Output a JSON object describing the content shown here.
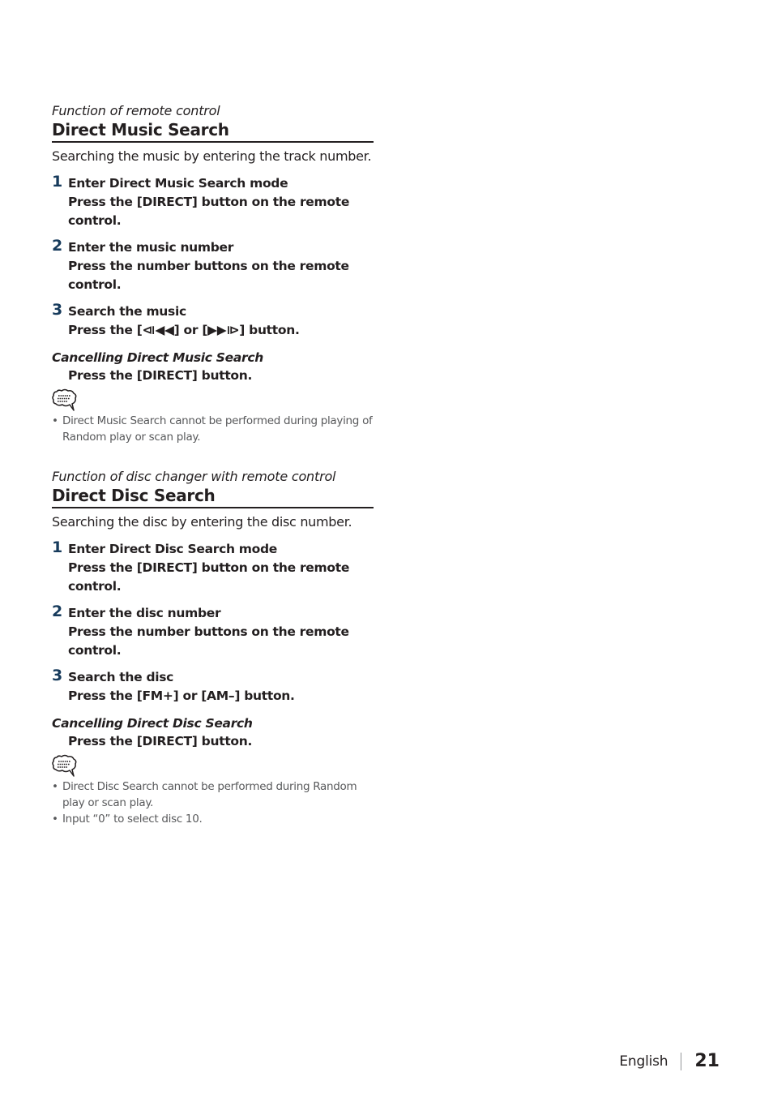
{
  "sections": [
    {
      "kicker": "Function of remote control",
      "title": "Direct Music Search",
      "intro": "Searching the music by entering the track number.",
      "steps": [
        {
          "num": "1",
          "head": "Enter Direct Music Search mode",
          "body": "Press the [DIRECT] button on the remote control."
        },
        {
          "num": "2",
          "head": "Enter the music number",
          "body": "Press the number buttons on the remote control."
        },
        {
          "num": "3",
          "head": "Search the music",
          "body": "Press the [⧏◀◀] or [▶▶⧐] button."
        }
      ],
      "cancel": {
        "head": "Cancelling Direct Music Search",
        "body": "Press the [DIRECT] button."
      },
      "note_icon": "note-speech-bubble-icon",
      "notes": [
        "Direct Music Search cannot be performed during playing of Random play or scan play."
      ]
    },
    {
      "kicker": "Function of disc changer with remote control",
      "title": "Direct Disc Search",
      "intro": "Searching the disc by entering the disc number.",
      "steps": [
        {
          "num": "1",
          "head": "Enter Direct Disc Search mode",
          "body": "Press the [DIRECT] button on the remote control."
        },
        {
          "num": "2",
          "head": "Enter the disc number",
          "body": "Press the number buttons on the remote control."
        },
        {
          "num": "3",
          "head": "Search the disc",
          "body": "Press the [FM+] or [AM–] button."
        }
      ],
      "cancel": {
        "head": "Cancelling Direct Disc Search",
        "body": "Press the [DIRECT] button."
      },
      "note_icon": "note-speech-bubble-icon",
      "notes": [
        "Direct Disc Search cannot be performed during Random play or scan play.",
        "Input “0” to select disc 10."
      ]
    }
  ],
  "footer": {
    "language": "English",
    "page_number": "21"
  },
  "bullet": "•",
  "colors": {
    "step_number": "#173b5c",
    "text": "#231f20",
    "note_text": "#58595b"
  }
}
